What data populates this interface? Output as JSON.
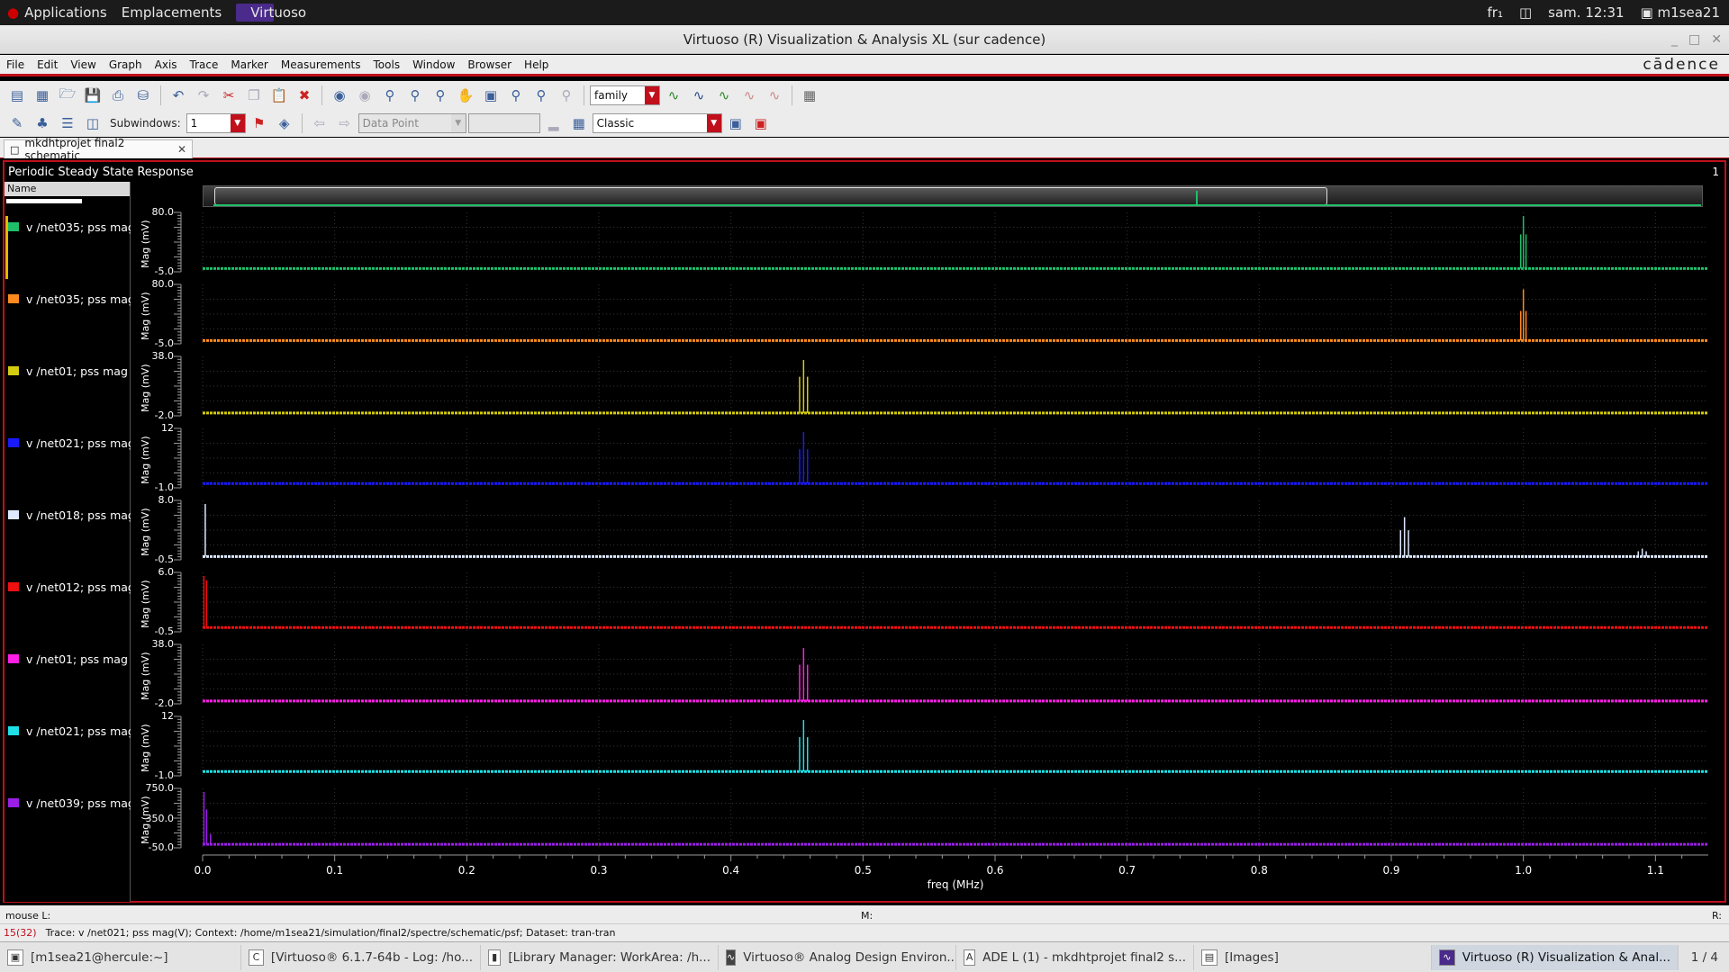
{
  "topbar": {
    "applications": "Applications",
    "places": "Emplacements",
    "app_name": "Virtuoso",
    "lang": "fr₁",
    "clock": "sam. 12:31",
    "user": "m1sea21"
  },
  "window": {
    "title": "Virtuoso (R) Visualization & Analysis XL (sur cadence)"
  },
  "menu": {
    "items": [
      "File",
      "Edit",
      "View",
      "Graph",
      "Axis",
      "Trace",
      "Marker",
      "Measurements",
      "Tools",
      "Window",
      "Browser",
      "Help"
    ],
    "logo": "cādence"
  },
  "toolbar": {
    "family_value": "family",
    "subwindows_label": "Subwindows:",
    "subwindows_value": "1",
    "datapoint_value": "Data Point",
    "style_value": "Classic"
  },
  "tab": {
    "label": "mkdhtprojet final2 schematic"
  },
  "panel": {
    "title": "Periodic Steady State Response",
    "subwindow_number": "1",
    "name_header": "Name"
  },
  "traces": [
    {
      "label": "v /net035; pss mag",
      "color": "#1fbf6a",
      "ymax": "80.0",
      "ymin": "-5.0"
    },
    {
      "label": "v /net035; pss mag",
      "color": "#ff8a1e",
      "ymax": "80.0",
      "ymin": "-5.0"
    },
    {
      "label": "v /net01; pss mag",
      "color": "#d4cc10",
      "ymax": "38.0",
      "ymin": "-2.0"
    },
    {
      "label": "v /net021; pss mag",
      "color": "#1a1aff",
      "ymax": "12",
      "ymin": "-1.0"
    },
    {
      "label": "v /net018; pss mag",
      "color": "#dde8ff",
      "ymax": "8.0",
      "ymin": "-0.5"
    },
    {
      "label": "v /net012; pss mag",
      "color": "#f01010",
      "ymax": "6.0",
      "ymin": "-0.5"
    },
    {
      "label": "v /net01; pss mag",
      "color": "#ff1ee6",
      "ymax": "38.0",
      "ymin": "-2.0"
    },
    {
      "label": "v /net021; pss mag",
      "color": "#1ee0e6",
      "ymax": "12",
      "ymin": "-1.0"
    },
    {
      "label": "v /net039; pss mag",
      "color": "#9a1ee6",
      "ymax": "750.0",
      "ymin": "-50.0",
      "ymid": "350.0"
    }
  ],
  "axis": {
    "ylabel": "Mag (mV)",
    "xlabel": "freq (MHz)",
    "xticks": [
      "0.0",
      "0.1",
      "0.2",
      "0.3",
      "0.4",
      "0.5",
      "0.6",
      "0.7",
      "0.8",
      "0.9",
      "1.0",
      "1.1"
    ]
  },
  "chart_data": {
    "type": "line",
    "xlabel": "freq (MHz)",
    "ylabel": "Mag (mV)",
    "xlim": [
      0,
      1.14
    ],
    "series": [
      {
        "name": "v /net035; pss mag",
        "ylim": [
          -5,
          80
        ],
        "peaks": [
          [
            1.0,
            80
          ],
          [
            0.998,
            52
          ],
          [
            1.002,
            52
          ]
        ]
      },
      {
        "name": "v /net035; pss mag",
        "ylim": [
          -5,
          80
        ],
        "peaks": [
          [
            1.0,
            78
          ],
          [
            0.998,
            45
          ],
          [
            1.002,
            45
          ]
        ]
      },
      {
        "name": "v /net01; pss mag",
        "ylim": [
          -2,
          38
        ],
        "peaks": [
          [
            0.455,
            38
          ],
          [
            0.452,
            26
          ],
          [
            0.458,
            26
          ]
        ]
      },
      {
        "name": "v /net021; pss mag",
        "ylim": [
          -1,
          12
        ],
        "peaks": [
          [
            0.455,
            12
          ],
          [
            0.452,
            8
          ],
          [
            0.458,
            8
          ]
        ]
      },
      {
        "name": "v /net018; pss mag",
        "ylim": [
          -0.5,
          8
        ],
        "peaks": [
          [
            0.002,
            8
          ],
          [
            0.91,
            6
          ],
          [
            0.907,
            4
          ],
          [
            0.913,
            4
          ],
          [
            1.09,
            1.2
          ],
          [
            1.087,
            0.8
          ],
          [
            1.093,
            0.8
          ]
        ]
      },
      {
        "name": "v /net012; pss mag",
        "ylim": [
          -0.5,
          6
        ],
        "peaks": [
          [
            0.001,
            6
          ],
          [
            0.003,
            5.5
          ]
        ]
      },
      {
        "name": "v /net01; pss mag",
        "ylim": [
          -2,
          38
        ],
        "peaks": [
          [
            0.455,
            38
          ],
          [
            0.452,
            26
          ],
          [
            0.458,
            26
          ]
        ]
      },
      {
        "name": "v /net021; pss mag",
        "ylim": [
          -1,
          12
        ],
        "peaks": [
          [
            0.455,
            12
          ],
          [
            0.452,
            8
          ],
          [
            0.458,
            8
          ]
        ]
      },
      {
        "name": "v /net039; pss mag",
        "ylim": [
          -50,
          750
        ],
        "peaks": [
          [
            0.001,
            750
          ],
          [
            0.003,
            500
          ],
          [
            0.006,
            150
          ]
        ]
      }
    ]
  },
  "status": {
    "mouse": "mouse L:",
    "middle": "M:",
    "right": "R:",
    "counter": "15(32)",
    "trace_info": "Trace: v /net021; pss mag(V); Context: /home/m1sea21/simulation/final2/spectre/schematic/psf; Dataset: tran-tran"
  },
  "taskbar": {
    "items": [
      "[m1sea21@hercule:~]",
      "[Virtuoso® 6.1.7-64b - Log: /ho...",
      "[Library Manager: WorkArea: /h...",
      "Virtuoso® Analog Design Environ...",
      "ADE L (1) - mkdhtprojet final2 s...",
      "[Images]",
      "Virtuoso (R) Visualization & Anal..."
    ],
    "pager": "1 / 4"
  }
}
